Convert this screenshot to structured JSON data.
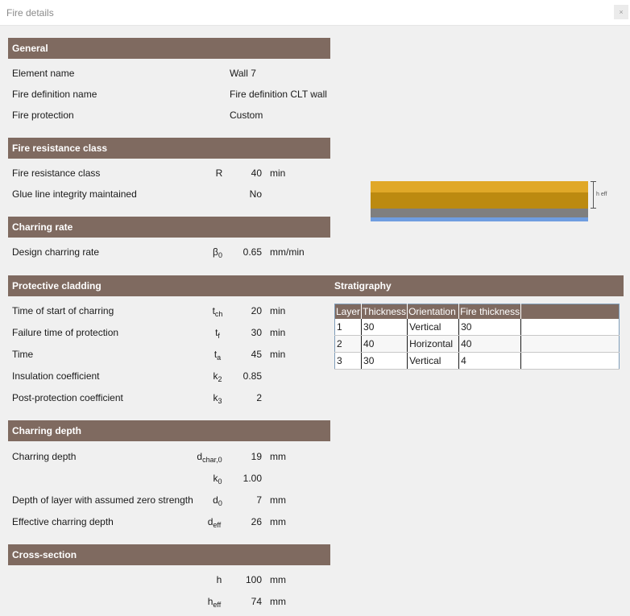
{
  "window": {
    "title": "Fire details",
    "close_glyph": "×"
  },
  "general": {
    "header": "General",
    "rows": [
      {
        "label": "Element name",
        "value": "Wall 7"
      },
      {
        "label": "Fire definition name",
        "value": "Fire definition CLT wall"
      },
      {
        "label": "Fire protection",
        "value": "Custom"
      }
    ]
  },
  "fire_resistance": {
    "header": "Fire resistance class",
    "class_label": "Fire resistance class",
    "class_symbol": "R",
    "class_value": "40",
    "class_unit": "min",
    "glue_label": "Glue line integrity maintained",
    "glue_value": "No"
  },
  "charring_rate": {
    "header": "Charring rate",
    "label": "Design charring rate",
    "symbol": "β",
    "symbol_sub": "0",
    "value": "0.65",
    "unit": "mm/min"
  },
  "protective_cladding": {
    "header": "Protective cladding",
    "stratigraphy_label": "Stratigraphy",
    "rows": [
      {
        "label": "Time of start of charring",
        "sym": "t",
        "sub": "ch",
        "value": "20",
        "unit": "min"
      },
      {
        "label": "Failure time of protection",
        "sym": "t",
        "sub": "f",
        "value": "30",
        "unit": "min"
      },
      {
        "label": "Time",
        "sym": "t",
        "sub": "a",
        "value": "45",
        "unit": "min"
      },
      {
        "label": "Insulation coefficient",
        "sym": "k",
        "sub": "2",
        "value": "0.85",
        "unit": ""
      },
      {
        "label": "Post-protection coefficient",
        "sym": "k",
        "sub": "3",
        "value": "2",
        "unit": ""
      }
    ]
  },
  "stratigraphy": {
    "columns": [
      "Layer",
      "Thickness",
      "Orientation",
      "Fire thickness"
    ],
    "rows": [
      [
        "1",
        "30",
        "Vertical",
        "30"
      ],
      [
        "2",
        "40",
        "Horizontal",
        "40"
      ],
      [
        "3",
        "30",
        "Vertical",
        "4"
      ]
    ]
  },
  "charring_depth": {
    "header": "Charring depth",
    "rows": [
      {
        "label": "Charring depth",
        "sym": "d",
        "sub": "char,0",
        "value": "19",
        "unit": "mm"
      },
      {
        "label": "",
        "sym": "k",
        "sub": "0",
        "value": "1.00",
        "unit": ""
      },
      {
        "label": "Depth of layer with assumed zero strength",
        "sym": "d",
        "sub": "0",
        "value": "7",
        "unit": "mm"
      },
      {
        "label": "Effective charring depth",
        "sym": "d",
        "sub": "eff",
        "value": "26",
        "unit": "mm"
      }
    ]
  },
  "cross_section": {
    "header": "Cross-section",
    "rows": [
      {
        "sym": "h",
        "sub": "",
        "value": "100",
        "unit": "mm"
      },
      {
        "sym": "h",
        "sub": "eff",
        "value": "74",
        "unit": "mm"
      }
    ],
    "preview_label": "h eff",
    "colors": {
      "top": "#e0a828",
      "middle": "#bc8a10",
      "bottom": "#7f7f7f",
      "base": "#6f9de0"
    }
  }
}
